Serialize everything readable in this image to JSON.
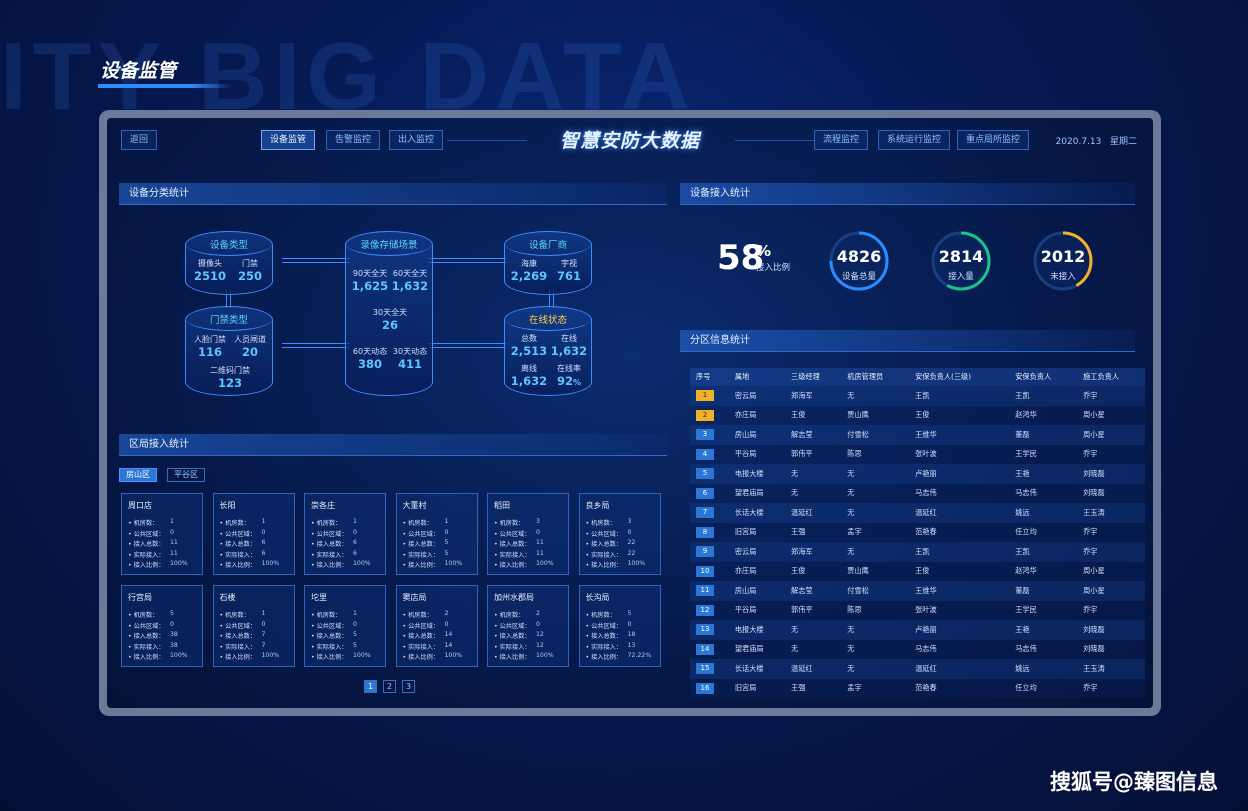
{
  "page": {
    "bg_text": "ITY BIG DATA",
    "title": "设备监管",
    "watermark": "搜狐号@臻图信息"
  },
  "colors": {
    "accent": "#2a77d8",
    "gold": "#f2b12a",
    "green": "#19c38c",
    "cyan": "#5ec6ff"
  },
  "nav": {
    "back": "返回",
    "left": [
      "设备监管",
      "告警监控",
      "出入监控"
    ],
    "right": [
      "流程监控",
      "系统运行监控",
      "重点局所监控"
    ],
    "title": "智慧安防大数据",
    "date": "2020.7.13",
    "weekday": "星期二"
  },
  "device_category": {
    "header": "设备分类统计",
    "device_type": {
      "title": "设备类型",
      "items": [
        {
          "label": "摄像头",
          "value": "2510"
        },
        {
          "label": "门禁",
          "value": "250"
        }
      ]
    },
    "door_type": {
      "title": "门禁类型",
      "items": [
        {
          "label": "人脸门禁",
          "value": "116"
        },
        {
          "label": "人员闸道",
          "value": "20"
        },
        {
          "label": "二维码门禁",
          "value": "123"
        }
      ]
    },
    "storage": {
      "title": "录像存储场景",
      "items": [
        {
          "label": "90天全天",
          "value": "1,625"
        },
        {
          "label": "60天全天",
          "value": "1,632"
        },
        {
          "label": "30天全天",
          "value": "26"
        },
        {
          "label": "60天动态",
          "value": "380"
        },
        {
          "label": "30天动态",
          "value": "411"
        }
      ]
    },
    "vendor": {
      "title": "设备厂商",
      "items": [
        {
          "label": "海康",
          "value": "2,269"
        },
        {
          "label": "宇视",
          "value": "761"
        }
      ]
    },
    "online": {
      "title": "在线状态",
      "items": [
        {
          "label": "总数",
          "value": "2,513"
        },
        {
          "label": "在线",
          "value": "1,632"
        },
        {
          "label": "离线",
          "value": "1,632"
        },
        {
          "label": "在线率",
          "value": "92",
          "unit": "%"
        }
      ]
    }
  },
  "district": {
    "header": "区局接入统计",
    "tabs": [
      "房山区",
      "平谷区"
    ],
    "row_labels": [
      "• 机房数：",
      "• 公共区域：",
      "• 接入总数：",
      "• 实际接入：",
      "• 接入比例："
    ],
    "cards": [
      {
        "name": "周口店",
        "values": [
          "1",
          "0",
          "11",
          "11",
          "100%"
        ]
      },
      {
        "name": "长阳",
        "values": [
          "1",
          "0",
          "6",
          "6",
          "100%"
        ]
      },
      {
        "name": "崇各庄",
        "values": [
          "1",
          "0",
          "6",
          "6",
          "100%"
        ]
      },
      {
        "name": "大董村",
        "values": [
          "1",
          "0",
          "5",
          "5",
          "100%"
        ]
      },
      {
        "name": "稻田",
        "values": [
          "3",
          "0",
          "11",
          "11",
          "100%"
        ]
      },
      {
        "name": "良乡局",
        "values": [
          "3",
          "0",
          "22",
          "22",
          "100%"
        ]
      },
      {
        "name": "行宫局",
        "values": [
          "5",
          "0",
          "38",
          "38",
          "100%"
        ]
      },
      {
        "name": "石楼",
        "values": [
          "1",
          "0",
          "7",
          "7",
          "100%"
        ]
      },
      {
        "name": "坨里",
        "values": [
          "1",
          "0",
          "5",
          "5",
          "100%"
        ]
      },
      {
        "name": "窦店局",
        "values": [
          "2",
          "0",
          "14",
          "14",
          "100%"
        ]
      },
      {
        "name": "加州水郡局",
        "values": [
          "2",
          "0",
          "12",
          "12",
          "100%"
        ]
      },
      {
        "name": "长沟局",
        "values": [
          "5",
          "0",
          "18",
          "13",
          "72.22%"
        ]
      }
    ],
    "pages": [
      "1",
      "2",
      "3"
    ]
  },
  "access": {
    "header": "设备接入统计",
    "ratio": {
      "value": "58",
      "unit": "%",
      "label": "接入比例"
    },
    "rings": [
      {
        "value": "4826",
        "label": "设备总量",
        "color": "#2a8cff",
        "fraction": 0.75
      },
      {
        "value": "2814",
        "label": "接入量",
        "color": "#19c38c",
        "fraction": 0.58
      },
      {
        "value": "2012",
        "label": "未接入",
        "color": "#f2b12a",
        "fraction": 0.42
      }
    ]
  },
  "zone": {
    "header": "分区信息统计",
    "columns": [
      "序号",
      "属地",
      "三级经理",
      "机房管理员",
      "安保负责人(三级)",
      "安保负责人",
      "施工负责人"
    ],
    "rows": [
      [
        "1",
        "密云局",
        "郑海军",
        "无",
        "王凯",
        "王凯",
        "乔宇"
      ],
      [
        "2",
        "亦庄局",
        "王俊",
        "贾山鹰",
        "王俊",
        "赵鸿华",
        "周小星"
      ],
      [
        "3",
        "房山局",
        "解志莹",
        "付雪松",
        "王维华",
        "董磊",
        "周小星"
      ],
      [
        "4",
        "平谷局",
        "郭伟平",
        "陈思",
        "张叶波",
        "王学民",
        "乔宇"
      ],
      [
        "5",
        "电报大楼",
        "无",
        "无",
        "卢艳丽",
        "王艳",
        "刘晓磊"
      ],
      [
        "6",
        "望君庙局",
        "无",
        "无",
        "马志伟",
        "马志伟",
        "刘晓磊"
      ],
      [
        "7",
        "长话大楼",
        "温延红",
        "无",
        "温延红",
        "姚远",
        "王玉涛"
      ],
      [
        "8",
        "旧宫局",
        "王强",
        "孟宇",
        "范艳春",
        "任立均",
        "乔宇"
      ],
      [
        "9",
        "密云局",
        "郑海军",
        "无",
        "王凯",
        "王凯",
        "乔宇"
      ],
      [
        "10",
        "亦庄局",
        "王俊",
        "贾山鹰",
        "王俊",
        "赵鸿华",
        "周小星"
      ],
      [
        "11",
        "房山局",
        "解志莹",
        "付雪松",
        "王维华",
        "董磊",
        "周小星"
      ],
      [
        "12",
        "平谷局",
        "郭伟平",
        "陈思",
        "张叶波",
        "王学民",
        "乔宇"
      ],
      [
        "13",
        "电报大楼",
        "无",
        "无",
        "卢艳丽",
        "王艳",
        "刘晓磊"
      ],
      [
        "14",
        "望君庙局",
        "无",
        "无",
        "马志伟",
        "马志伟",
        "刘晓磊"
      ],
      [
        "15",
        "长话大楼",
        "温延红",
        "无",
        "温延红",
        "姚远",
        "王玉涛"
      ],
      [
        "16",
        "旧宫局",
        "王强",
        "孟宇",
        "范艳春",
        "任立均",
        "乔宇"
      ]
    ],
    "highlight_rows": [
      1,
      2
    ]
  }
}
